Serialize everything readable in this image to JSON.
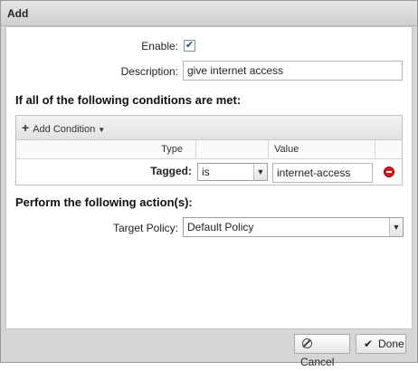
{
  "dialog": {
    "title": "Add"
  },
  "form": {
    "enable_label": "Enable:",
    "enable_checked": true,
    "description_label": "Description:",
    "description_value": "give internet access"
  },
  "conditions": {
    "heading": "If all of the following conditions are met:",
    "add_condition_label": "Add Condition",
    "columns": [
      "Type",
      "",
      "Value",
      ""
    ],
    "rows": [
      {
        "type": "Tagged:",
        "operator": "is",
        "value": "internet-access"
      }
    ]
  },
  "actions": {
    "heading": "Perform the following action(s):",
    "target_policy_label": "Target Policy:",
    "target_policy_value": "Default Policy"
  },
  "footer": {
    "cancel_label": "Cancel",
    "done_label": "Done"
  }
}
